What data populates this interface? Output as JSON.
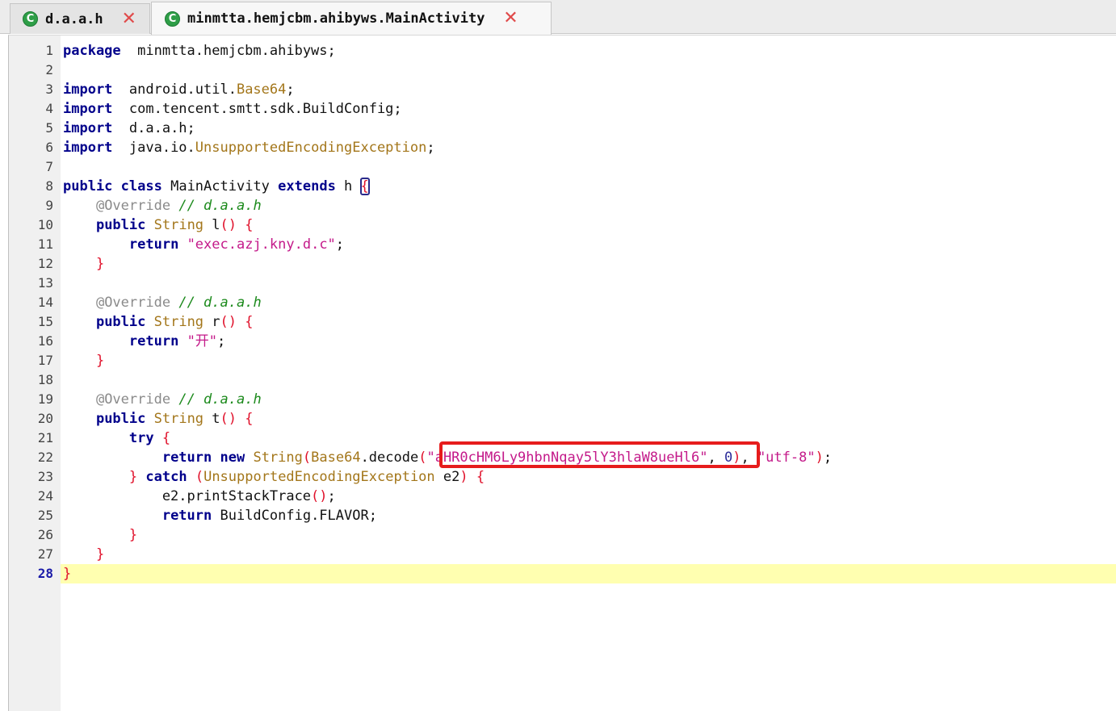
{
  "tabs": [
    {
      "label": "d.a.a.h",
      "icon": "c-class-icon",
      "close_symbol": "✕"
    },
    {
      "label": "minmtta.hemjcbm.ahibyws.MainActivity",
      "icon": "c-class-icon",
      "close_symbol": "✕"
    }
  ],
  "tab_icon_letter": "C",
  "current_line": 28,
  "highlight_color": "#e61c1c",
  "lines": [
    {
      "n": "1",
      "segs": [
        [
          "kw",
          "package"
        ],
        [
          "",
          "  minmtta.hemjcbm.ahibyws;"
        ]
      ]
    },
    {
      "n": "2",
      "segs": []
    },
    {
      "n": "3",
      "segs": [
        [
          "kw",
          "import"
        ],
        [
          "",
          "  android.util."
        ],
        [
          "typ",
          "Base64"
        ],
        [
          "",
          ";"
        ]
      ]
    },
    {
      "n": "4",
      "segs": [
        [
          "kw",
          "import"
        ],
        [
          "",
          "  com.tencent.smtt.sdk.BuildConfig;"
        ]
      ]
    },
    {
      "n": "5",
      "segs": [
        [
          "kw",
          "import"
        ],
        [
          "",
          "  d.a.a.h;"
        ]
      ]
    },
    {
      "n": "6",
      "segs": [
        [
          "kw",
          "import"
        ],
        [
          "",
          "  java.io."
        ],
        [
          "typ",
          "UnsupportedEncodingException"
        ],
        [
          "",
          ";"
        ]
      ]
    },
    {
      "n": "7",
      "segs": []
    },
    {
      "n": "8",
      "segs": [
        [
          "kw",
          "public"
        ],
        [
          "",
          " "
        ],
        [
          "kw",
          "class"
        ],
        [
          "",
          " MainActivity "
        ],
        [
          "kw",
          "extends"
        ],
        [
          "",
          " h "
        ],
        [
          "hl",
          "{"
        ]
      ]
    },
    {
      "n": "9",
      "segs": [
        [
          "",
          "    "
        ],
        [
          "ann",
          "@Override"
        ],
        [
          "",
          " "
        ],
        [
          "cmt",
          "// d.a.a.h"
        ]
      ]
    },
    {
      "n": "10",
      "segs": [
        [
          "",
          "    "
        ],
        [
          "kw",
          "public"
        ],
        [
          "",
          " "
        ],
        [
          "typ",
          "String"
        ],
        [
          "",
          " l"
        ],
        [
          "br",
          "()"
        ],
        [
          "",
          " "
        ],
        [
          "br",
          "{"
        ]
      ]
    },
    {
      "n": "11",
      "segs": [
        [
          "",
          "        "
        ],
        [
          "kw",
          "return"
        ],
        [
          "",
          " "
        ],
        [
          "str",
          "\"exec.azj.kny.d.c\""
        ],
        [
          "",
          ";"
        ]
      ]
    },
    {
      "n": "12",
      "segs": [
        [
          "",
          "    "
        ],
        [
          "br",
          "}"
        ]
      ]
    },
    {
      "n": "13",
      "segs": []
    },
    {
      "n": "14",
      "segs": [
        [
          "",
          "    "
        ],
        [
          "ann",
          "@Override"
        ],
        [
          "",
          " "
        ],
        [
          "cmt",
          "// d.a.a.h"
        ]
      ]
    },
    {
      "n": "15",
      "segs": [
        [
          "",
          "    "
        ],
        [
          "kw",
          "public"
        ],
        [
          "",
          " "
        ],
        [
          "typ",
          "String"
        ],
        [
          "",
          " r"
        ],
        [
          "br",
          "()"
        ],
        [
          "",
          " "
        ],
        [
          "br",
          "{"
        ]
      ]
    },
    {
      "n": "16",
      "segs": [
        [
          "",
          "        "
        ],
        [
          "kw",
          "return"
        ],
        [
          "",
          " "
        ],
        [
          "str",
          "\"开\""
        ],
        [
          "",
          ";"
        ]
      ]
    },
    {
      "n": "17",
      "segs": [
        [
          "",
          "    "
        ],
        [
          "br",
          "}"
        ]
      ]
    },
    {
      "n": "18",
      "segs": []
    },
    {
      "n": "19",
      "segs": [
        [
          "",
          "    "
        ],
        [
          "ann",
          "@Override"
        ],
        [
          "",
          " "
        ],
        [
          "cmt",
          "// d.a.a.h"
        ]
      ]
    },
    {
      "n": "20",
      "segs": [
        [
          "",
          "    "
        ],
        [
          "kw",
          "public"
        ],
        [
          "",
          " "
        ],
        [
          "typ",
          "String"
        ],
        [
          "",
          " t"
        ],
        [
          "br",
          "()"
        ],
        [
          "",
          " "
        ],
        [
          "br",
          "{"
        ]
      ]
    },
    {
      "n": "21",
      "segs": [
        [
          "",
          "        "
        ],
        [
          "kw",
          "try"
        ],
        [
          "",
          " "
        ],
        [
          "br",
          "{"
        ]
      ]
    },
    {
      "n": "22",
      "segs": [
        [
          "",
          "            "
        ],
        [
          "kw",
          "return"
        ],
        [
          "",
          " "
        ],
        [
          "kw",
          "new"
        ],
        [
          "",
          " "
        ],
        [
          "typ",
          "String"
        ],
        [
          "br",
          "("
        ],
        [
          "typ",
          "Base64"
        ],
        [
          "",
          ".decode"
        ],
        [
          "br",
          "("
        ],
        [
          "str",
          "\"aHR0cHM6Ly9hbnNqay5lY3hlaW8ueHl6\""
        ],
        [
          "",
          ", "
        ],
        [
          "num",
          "0"
        ],
        [
          "br",
          ")"
        ],
        [
          "",
          ", "
        ],
        [
          "str",
          "\"utf-8\""
        ],
        [
          "br",
          ")"
        ],
        [
          "",
          ";"
        ]
      ]
    },
    {
      "n": "23",
      "segs": [
        [
          "",
          "        "
        ],
        [
          "br",
          "}"
        ],
        [
          "",
          " "
        ],
        [
          "kw",
          "catch"
        ],
        [
          "",
          " "
        ],
        [
          "br",
          "("
        ],
        [
          "typ",
          "UnsupportedEncodingException"
        ],
        [
          "",
          " e2"
        ],
        [
          "br",
          ")"
        ],
        [
          "",
          " "
        ],
        [
          "br",
          "{"
        ]
      ]
    },
    {
      "n": "24",
      "segs": [
        [
          "",
          "            e2.printStackTrace"
        ],
        [
          "br",
          "()"
        ],
        [
          "",
          ";"
        ]
      ]
    },
    {
      "n": "25",
      "segs": [
        [
          "",
          "            "
        ],
        [
          "kw",
          "return"
        ],
        [
          "",
          " BuildConfig.FLAVOR;"
        ]
      ]
    },
    {
      "n": "26",
      "segs": [
        [
          "",
          "        "
        ],
        [
          "br",
          "}"
        ]
      ]
    },
    {
      "n": "27",
      "segs": [
        [
          "",
          "    "
        ],
        [
          "br",
          "}"
        ]
      ]
    },
    {
      "n": "28",
      "segs": [
        [
          "br",
          "}"
        ]
      ]
    }
  ]
}
